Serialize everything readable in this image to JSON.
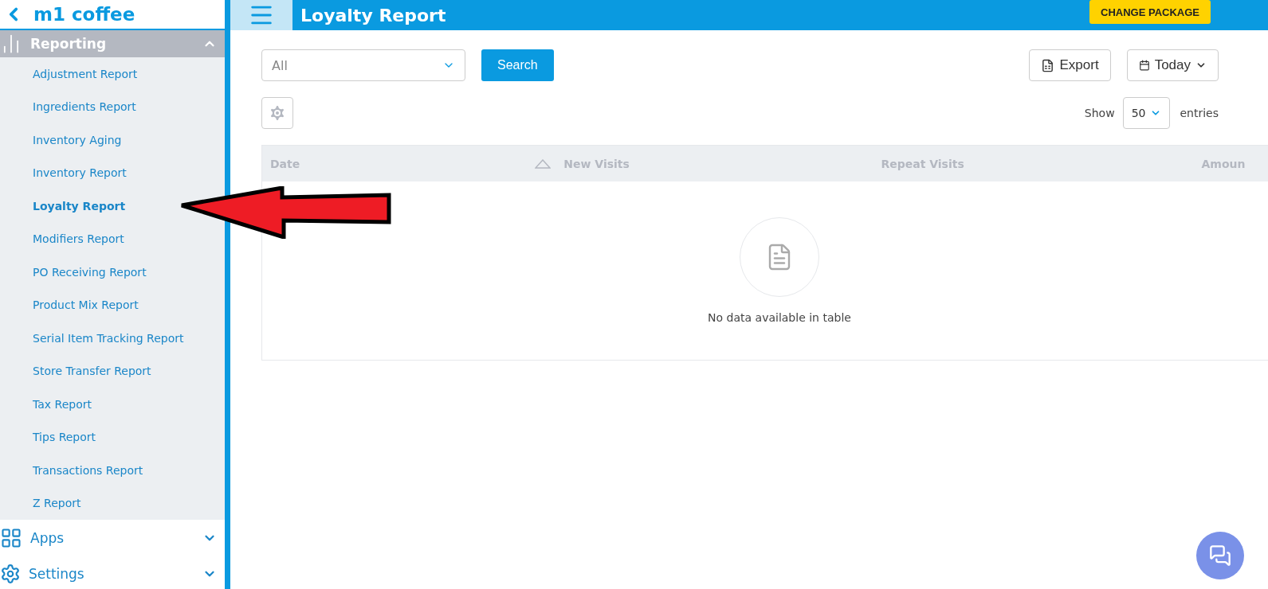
{
  "brand": {
    "title": "m1 coffee"
  },
  "sidebar": {
    "sections": [
      {
        "kind": "chart",
        "label": "Reporting",
        "expanded": true,
        "items": [
          {
            "label": "Adjustment Report",
            "selected": false
          },
          {
            "label": "Ingredients Report",
            "selected": false
          },
          {
            "label": "Inventory Aging",
            "selected": false
          },
          {
            "label": "Inventory Report",
            "selected": false
          },
          {
            "label": "Loyalty Report",
            "selected": true
          },
          {
            "label": "Modifiers Report",
            "selected": false
          },
          {
            "label": "PO Receiving Report",
            "selected": false
          },
          {
            "label": "Product Mix Report",
            "selected": false
          },
          {
            "label": "Serial Item Tracking Report",
            "selected": false
          },
          {
            "label": "Store Transfer Report",
            "selected": false
          },
          {
            "label": "Tax Report",
            "selected": false
          },
          {
            "label": "Tips Report",
            "selected": false
          },
          {
            "label": "Transactions Report",
            "selected": false
          },
          {
            "label": "Z Report",
            "selected": false
          }
        ]
      },
      {
        "kind": "apps",
        "label": "Apps",
        "expanded": false
      },
      {
        "kind": "settings",
        "label": "Settings",
        "expanded": false
      }
    ]
  },
  "header": {
    "title": "Loyalty Report",
    "action": "CHANGE PACKAGE"
  },
  "filters": {
    "select_value": "All",
    "search": "Search",
    "export": "Export",
    "range": "Today"
  },
  "page_size": {
    "before": "Show",
    "value": "50",
    "after": "entries"
  },
  "table": {
    "columns": [
      {
        "label": "Date",
        "sorted": true
      },
      {
        "label": "New Visits",
        "sorted": false
      },
      {
        "label": "Repeat Visits",
        "sorted": false
      },
      {
        "label": "Amoun",
        "sorted": false
      }
    ],
    "empty_text": "No data available in table"
  }
}
